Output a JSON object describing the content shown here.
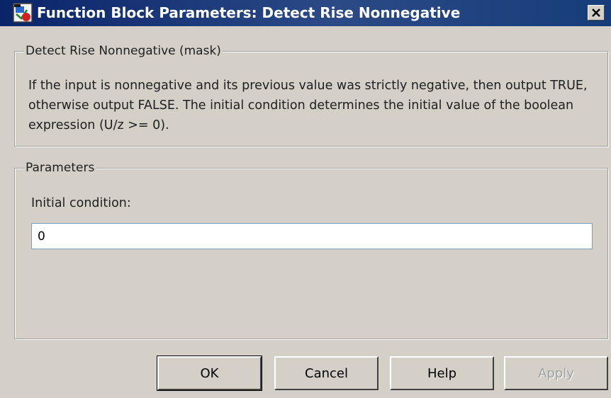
{
  "window": {
    "title": "Function Block Parameters: Detect Rise Nonnegative",
    "close_icon": "close-icon",
    "app_icon": "simulink-block-icon"
  },
  "mask_group": {
    "legend": "Detect Rise Nonnegative (mask)",
    "description": "If the input is nonnegative and its previous value was strictly negative, then output TRUE, otherwise output FALSE.  The initial condition determines the initial value of the boolean expression (U/z >= 0)."
  },
  "params_group": {
    "legend": "Parameters",
    "initial_condition_label": "Initial condition:",
    "initial_condition_value": "0"
  },
  "buttons": {
    "ok": "OK",
    "cancel": "Cancel",
    "help": "Help",
    "apply": "Apply"
  },
  "colors": {
    "titlebar": "#0a246a",
    "dialog_bg": "#d4d0c8",
    "disabled_text": "#a0a0a0"
  }
}
